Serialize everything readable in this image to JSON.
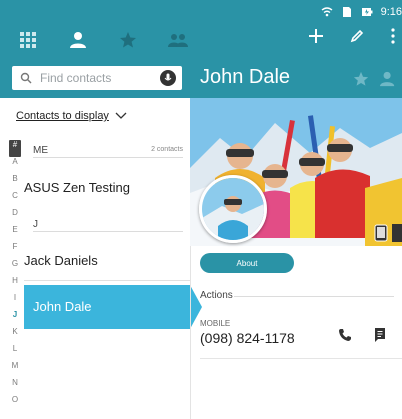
{
  "status_bar": {
    "time": "9:16"
  },
  "tabs": [
    {
      "name": "dialpad-tab",
      "icon": "grid-icon"
    },
    {
      "name": "contacts-tab",
      "icon": "person-icon"
    },
    {
      "name": "favorites-tab",
      "icon": "star-icon"
    },
    {
      "name": "groups-tab",
      "icon": "group-icon"
    }
  ],
  "search": {
    "placeholder": "Find contacts"
  },
  "contacts_filter": {
    "label": "Contacts to display"
  },
  "alphabet": [
    "#",
    "A",
    "B",
    "C",
    "D",
    "E",
    "F",
    "G",
    "H",
    "I",
    "J",
    "K",
    "L",
    "M",
    "N",
    "O"
  ],
  "sections": {
    "me": {
      "header": "ME",
      "count": "2 contacts"
    },
    "j": {
      "header": "J"
    }
  },
  "contacts": {
    "asus": "ASUS Zen Testing",
    "jack": "Jack Daniels",
    "john": "John Dale"
  },
  "detail": {
    "name": "John Dale",
    "about_button": "About",
    "actions_label": "Actions",
    "mobile_label": "MOBILE",
    "phone": "(098) 824-1178"
  },
  "colors": {
    "accent": "#2a93a6",
    "selected": "#3bb5dc"
  }
}
